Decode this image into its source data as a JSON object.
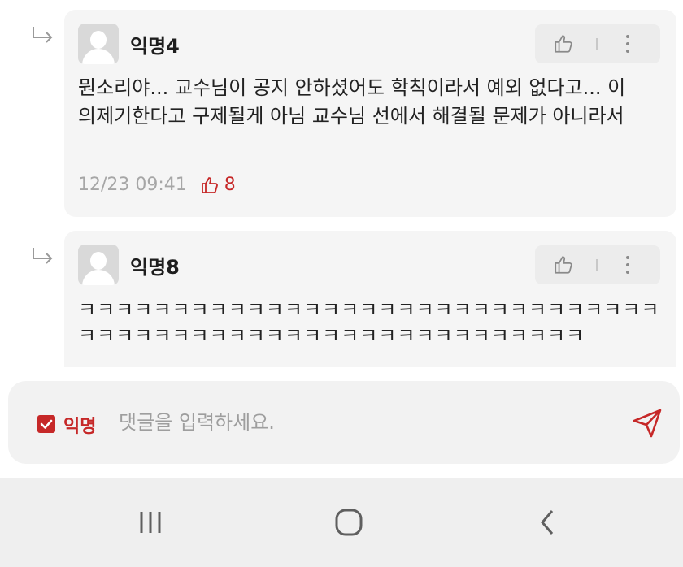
{
  "comments": [
    {
      "author": "익명4",
      "text": "뭔소리야... 교수님이 공지 안하셨어도 학칙이라서 예외 없다고... 이의제기한다고 구제될게 아님 교수님 선에서 해결될 문제가 아니라서",
      "time": "12/23 09:41",
      "likes": "8"
    },
    {
      "author": "익명8",
      "text": "ㅋㅋㅋㅋㅋㅋㅋㅋㅋㅋㅋㅋㅋㅋㅋㅋㅋㅋㅋㅋㅋㅋㅋㅋㅋㅋㅋㅋㅋㅋㅋㅋㅋㅋㅋㅋㅋㅋㅋㅋㅋㅋㅋㅋㅋㅋㅋㅋㅋㅋㅋㅋㅋㅋㅋㅋㅋㅋ"
    }
  ],
  "input_bar": {
    "anonymous_label": "익명",
    "anonymous_checked": true,
    "placeholder": "댓글을 입력하세요."
  },
  "icons": {
    "reply": "reply-arrow-icon",
    "like": "thumbs-up-icon",
    "more": "more-vertical-icon",
    "send": "send-icon",
    "nav_recent": "recent-apps-icon",
    "nav_home": "home-icon",
    "nav_back": "back-icon"
  },
  "colors": {
    "accent": "#c62828",
    "card_bg": "#f5f5f5"
  }
}
